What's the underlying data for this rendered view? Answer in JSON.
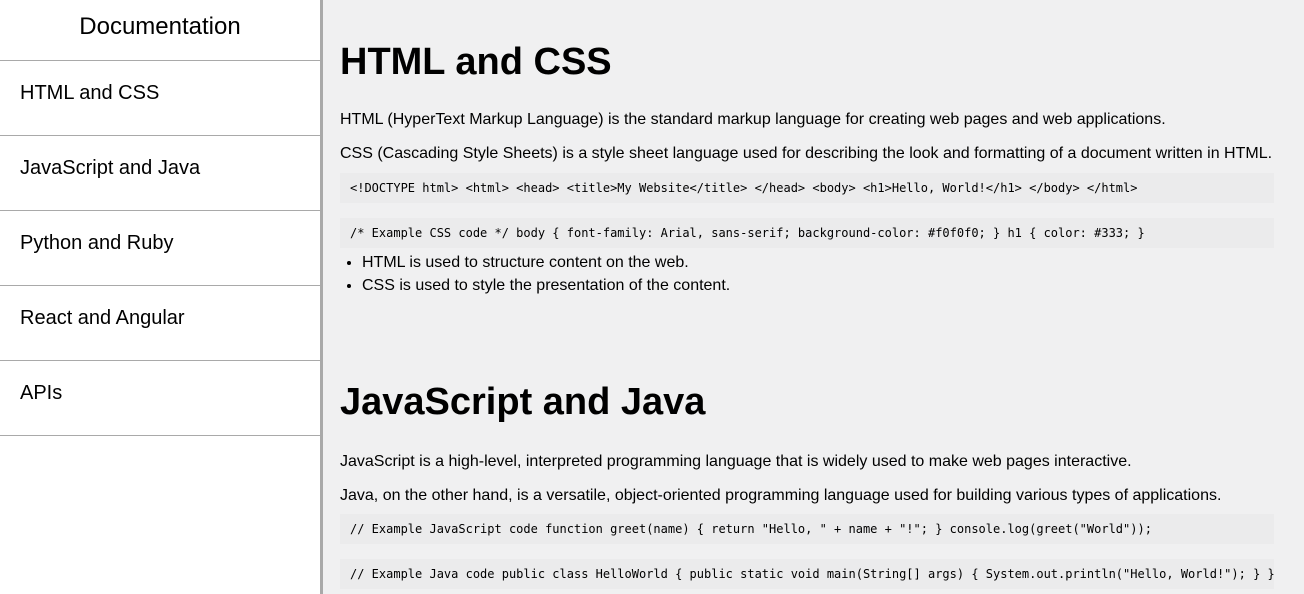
{
  "navbar": {
    "header": "Documentation",
    "items": [
      {
        "label": "HTML and CSS"
      },
      {
        "label": "JavaScript and Java"
      },
      {
        "label": "Python and Ruby"
      },
      {
        "label": "React and Angular"
      },
      {
        "label": "APIs"
      }
    ]
  },
  "sections": [
    {
      "title": "HTML and CSS",
      "paragraphs": [
        "HTML (HyperText Markup Language) is the standard markup language for creating web pages and web applications.",
        "CSS (Cascading Style Sheets) is a style sheet language used for describing the look and formatting of a document written in HTML."
      ],
      "code": [
        "<!DOCTYPE html> <html> <head> <title>My Website</title> </head> <body> <h1>Hello, World!</h1> </body> </html>",
        "/* Example CSS code */ body { font-family: Arial, sans-serif; background-color: #f0f0f0; } h1 { color: #333; }"
      ],
      "list": [
        "HTML is used to structure content on the web.",
        "CSS is used to style the presentation of the content."
      ]
    },
    {
      "title": "JavaScript and Java",
      "paragraphs": [
        "JavaScript is a high-level, interpreted programming language that is widely used to make web pages interactive.",
        "Java, on the other hand, is a versatile, object-oriented programming language used for building various types of applications."
      ],
      "code": [
        "// Example JavaScript code function greet(name) { return \"Hello, \" + name + \"!\"; } console.log(greet(\"World\"));",
        "// Example Java code public class HelloWorld { public static void main(String[] args) { System.out.println(\"Hello, World!\"); } }"
      ]
    }
  ]
}
